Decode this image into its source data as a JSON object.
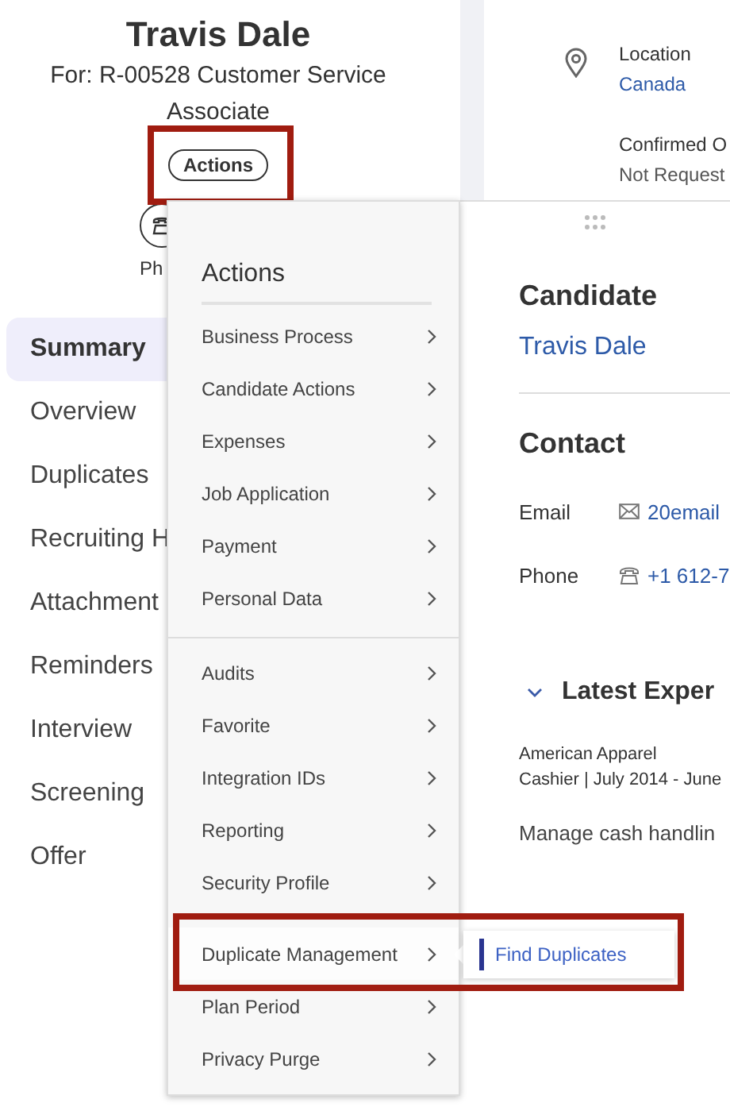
{
  "profile": {
    "name": "Travis Dale",
    "subtitle": "For: R-00528 Customer Service Associate",
    "actions_button": {
      "label": "Actions",
      "highlighted": true
    },
    "phone_label": "Ph"
  },
  "nav": [
    {
      "label": "Summary",
      "selected": true
    },
    {
      "label": "Overview",
      "selected": false
    },
    {
      "label": "Duplicates",
      "selected": false
    },
    {
      "label": "Recruiting H",
      "selected": false
    },
    {
      "label": "Attachment",
      "selected": false
    },
    {
      "label": "Reminders",
      "selected": false
    },
    {
      "label": "Interview",
      "selected": false
    },
    {
      "label": "Screening",
      "selected": false
    },
    {
      "label": "Offer",
      "selected": false
    }
  ],
  "details": [
    {
      "kind": "location",
      "label": "Location",
      "value": "Canada"
    },
    {
      "kind": "plain",
      "label": "Confirmed O",
      "value": "Not Request"
    }
  ],
  "candidate_panel": {
    "heading": "Candidate",
    "name": "Travis Dale",
    "contact_heading": "Contact",
    "contacts": [
      {
        "kind": "email",
        "label": "Email",
        "value": "20email"
      },
      {
        "kind": "phone",
        "label": "Phone",
        "value": "+1 612-7"
      }
    ],
    "experience": {
      "heading": "Latest Exper",
      "expanded": true,
      "company": "American Apparel",
      "role": "Cashier | July 2014 - June",
      "description": "Manage cash handlin"
    }
  },
  "actions_menu": {
    "title": "Actions",
    "groups": [
      {
        "items": [
          {
            "label": "Business Process",
            "highlighted": false
          },
          {
            "label": "Candidate Actions",
            "highlighted": false
          },
          {
            "label": "Expenses",
            "highlighted": false
          },
          {
            "label": "Job Application",
            "highlighted": false
          },
          {
            "label": "Payment",
            "highlighted": false
          },
          {
            "label": "Personal Data",
            "highlighted": false
          }
        ]
      },
      {
        "items": [
          {
            "label": "Audits",
            "highlighted": false
          },
          {
            "label": "Favorite",
            "highlighted": false
          },
          {
            "label": "Integration IDs",
            "highlighted": false
          },
          {
            "label": "Reporting",
            "highlighted": false
          },
          {
            "label": "Security Profile",
            "highlighted": false
          },
          {
            "label": "Duplicate Management",
            "highlighted": true,
            "submenu": [
              {
                "label": "Find Duplicates",
                "selected": true
              }
            ]
          },
          {
            "label": "Plan Period",
            "highlighted": false
          },
          {
            "label": "Privacy Purge",
            "highlighted": false
          }
        ]
      }
    ]
  }
}
